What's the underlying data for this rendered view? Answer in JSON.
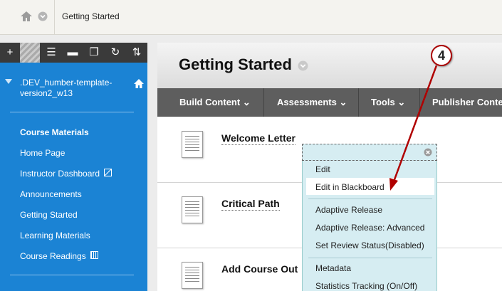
{
  "breadcrumb": {
    "current": "Getting Started"
  },
  "sidebar": {
    "course_title": ".DEV_humber-template-version2_w13",
    "items": [
      {
        "label": "Course Materials",
        "bold": true
      },
      {
        "label": "Home Page"
      },
      {
        "label": "Instructor Dashboard"
      },
      {
        "label": "Announcements"
      },
      {
        "label": "Getting Started"
      },
      {
        "label": "Learning Materials"
      },
      {
        "label": "Course Readings"
      }
    ]
  },
  "main": {
    "title": "Getting Started",
    "actions": [
      "Build Content",
      "Assessments",
      "Tools",
      "Publisher Conte"
    ],
    "items": [
      "Welcome Letter",
      "Critical Path",
      "Add Course Out"
    ]
  },
  "context_menu": {
    "items": [
      "Edit",
      "Edit in Blackboard",
      "Adaptive Release",
      "Adaptive Release: Advanced",
      "Set Review Status(Disabled)",
      "Metadata",
      "Statistics Tracking (On/Off)"
    ]
  },
  "annotation": {
    "step": "4"
  },
  "colors": {
    "sidebar": "#1b83d4",
    "action_bar": "#5e5e5e",
    "menu": "#d6edf2",
    "arrow": "#b00000"
  },
  "icons": [
    "home-icon",
    "chevron-down-icon",
    "plus-icon",
    "list-icon",
    "folder-icon",
    "windows-icon",
    "refresh-icon",
    "sort-icon",
    "close-icon",
    "document-icon"
  ]
}
